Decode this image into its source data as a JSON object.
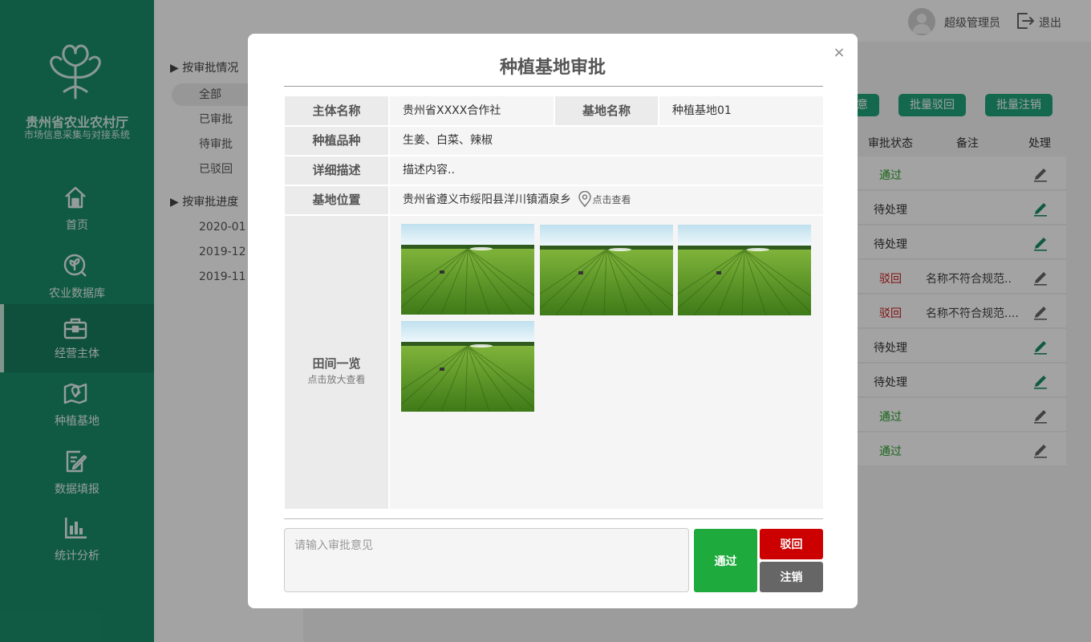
{
  "brand": {
    "title": "贵州省农业农村厅",
    "subtitle": "市场信息采集与对接系统"
  },
  "nav": [
    {
      "label": "首页",
      "icon": "home-icon"
    },
    {
      "label": "农业数据库",
      "icon": "database-icon"
    },
    {
      "label": "经营主体",
      "icon": "briefcase-icon",
      "active": true
    },
    {
      "label": "种植基地",
      "icon": "map-icon"
    },
    {
      "label": "数据填报",
      "icon": "edit-form-icon"
    },
    {
      "label": "统计分析",
      "icon": "bar-chart-icon"
    }
  ],
  "topbar": {
    "user": "超级管理员",
    "logout": "退出"
  },
  "filter": {
    "by_status_label": "按审批情况",
    "status_items": [
      "全部",
      "已审批",
      "待审批",
      "已驳回"
    ],
    "by_progress_label": "按审批进度",
    "progress_items": [
      "2020-01",
      "2019-12",
      "2019-11"
    ]
  },
  "toolbar": {
    "approve": "同意",
    "reject": "批量驳回",
    "cancel": "批量注销"
  },
  "table": {
    "headers": {
      "status": "审批状态",
      "note": "备注",
      "action": "处理"
    },
    "rows": [
      {
        "status": "通过",
        "type": "pass",
        "note": ""
      },
      {
        "status": "待处理",
        "type": "wait",
        "note": ""
      },
      {
        "status": "待处理",
        "type": "wait",
        "note": ""
      },
      {
        "status": "驳回",
        "type": "rej",
        "note": "名称不符合规范.."
      },
      {
        "status": "驳回",
        "type": "rej",
        "note": "名称不符合规范...."
      },
      {
        "status": "待处理",
        "type": "wait",
        "note": ""
      },
      {
        "status": "待处理",
        "type": "wait",
        "note": ""
      },
      {
        "status": "通过",
        "type": "pass",
        "note": ""
      },
      {
        "status": "通过",
        "type": "pass",
        "note": ""
      }
    ]
  },
  "modal": {
    "title": "种植基地审批",
    "close": "×",
    "subject_label": "主体名称",
    "subject_value": "贵州省XXXX合作社",
    "base_label": "基地名称",
    "base_value": "种植基地01",
    "variety_label": "种植品种",
    "variety_value": "生姜、白菜、辣椒",
    "desc_label": "详细描述",
    "desc_value": "描述内容..",
    "location_label": "基地位置",
    "location_value": "贵州省遵义市绥阳县洋川镇酒泉乡",
    "location_link": "点击查看",
    "photos_label": "田间一览",
    "photos_hint": "点击放大查看",
    "photo_count": 4,
    "opinion_placeholder": "请输入审批意见",
    "pass_btn": "通过",
    "reject_btn": "驳回",
    "cancel_btn": "注销"
  },
  "colors": {
    "sidebar": "#1a8e6a",
    "accent": "#1fa37a",
    "pass": "#1eaa3d",
    "reject": "#cc0000",
    "cancel": "#666666"
  }
}
